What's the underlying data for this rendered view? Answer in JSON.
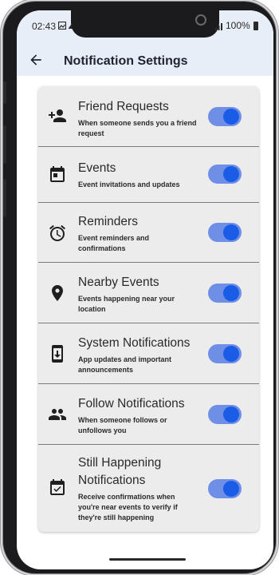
{
  "status_bar": {
    "time": "02:43",
    "signal_battery": "100%"
  },
  "header": {
    "title": "Notification Settings",
    "back_icon": "arrow-left-icon"
  },
  "settings": [
    {
      "title": "Friend Requests",
      "description": "When someone sends you a friend request",
      "icon": "person-add-icon",
      "enabled": true
    },
    {
      "title": "Events",
      "description": "Event invitations and updates",
      "icon": "calendar-icon",
      "enabled": true
    },
    {
      "title": "Reminders",
      "description": "Event reminders and confirmations",
      "icon": "alarm-clock-icon",
      "enabled": true
    },
    {
      "title": "Nearby Events",
      "description": "Events happening near your location",
      "icon": "location-pin-icon",
      "enabled": true
    },
    {
      "title": "System Notifications",
      "description": "App updates and important announcements",
      "icon": "system-update-icon",
      "enabled": true
    },
    {
      "title": "Follow Notifications",
      "description": "When someone follows or unfollows you",
      "icon": "people-icon",
      "enabled": true
    },
    {
      "title": "Still Happening Notifications",
      "description": "Receive confirmations when you're near events to verify if they're still happening",
      "icon": "calendar-check-icon",
      "enabled": true
    }
  ],
  "colors": {
    "header_bg": "#e8eef7",
    "card_bg": "#ececec",
    "toggle_track": "#6f8fe6",
    "toggle_knob": "#1a5ce6"
  }
}
